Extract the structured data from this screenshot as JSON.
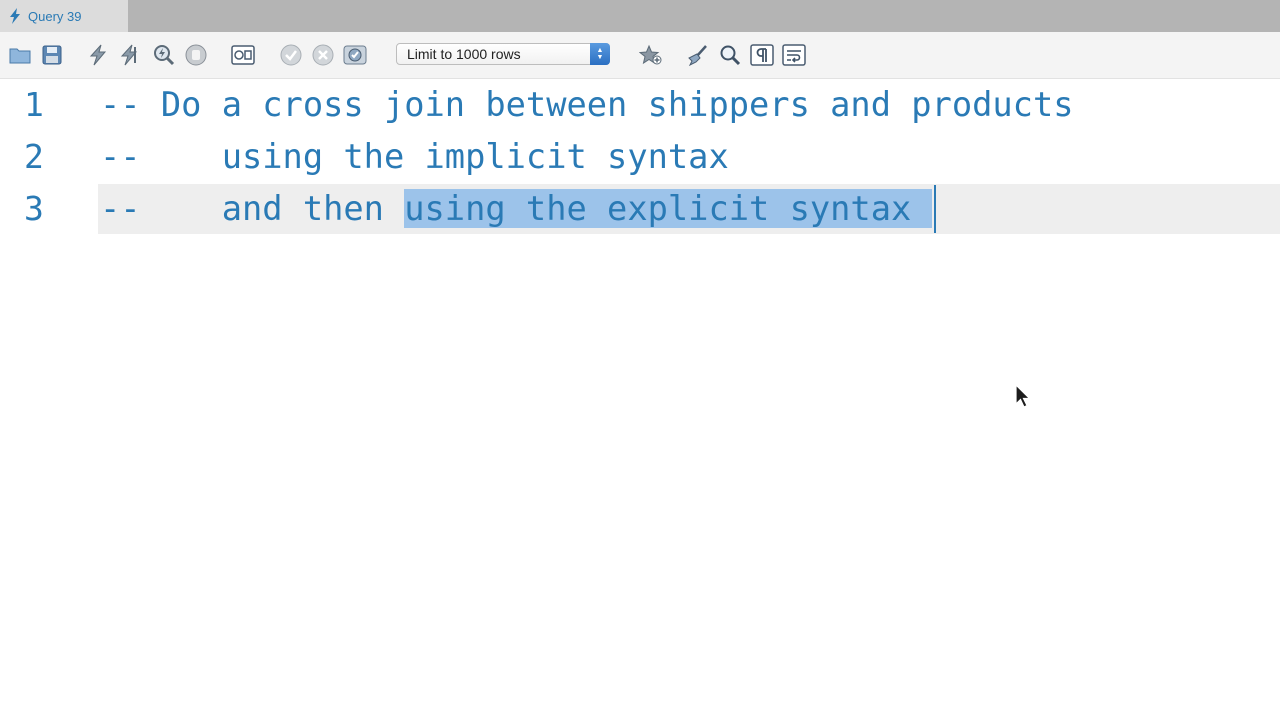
{
  "tab": {
    "title": "Query 39",
    "icon": "lightning-icon"
  },
  "toolbar": {
    "buttons": [
      {
        "name": "open-file",
        "icon": "folder-icon"
      },
      {
        "name": "save-file",
        "icon": "save-icon"
      },
      {
        "name": "execute",
        "icon": "lightning-icon"
      },
      {
        "name": "execute-current",
        "icon": "lightning-cursor-icon"
      },
      {
        "name": "explain",
        "icon": "magnifier-icon"
      },
      {
        "name": "stop",
        "icon": "stop-icon"
      },
      {
        "name": "toggle-results",
        "icon": "results-icon"
      },
      {
        "name": "commit",
        "icon": "check-circle-icon"
      },
      {
        "name": "rollback",
        "icon": "x-circle-icon"
      },
      {
        "name": "autocommit",
        "icon": "autocommit-icon"
      },
      {
        "name": "snippet",
        "icon": "star-icon"
      },
      {
        "name": "beautify",
        "icon": "broom-icon"
      },
      {
        "name": "find",
        "icon": "search-icon"
      },
      {
        "name": "invisible-chars",
        "icon": "pilcrow-icon"
      },
      {
        "name": "word-wrap",
        "icon": "wrap-icon"
      }
    ],
    "limit": {
      "value": "Limit to 1000 rows"
    }
  },
  "editor": {
    "lines": [
      {
        "number": "1",
        "text": "-- Do a cross join between shippers and products"
      },
      {
        "number": "2",
        "text": "--    using the implicit syntax"
      },
      {
        "number": "3",
        "text_before": "--    and then ",
        "text_selected": "using the explicit syntax "
      }
    ]
  },
  "colors": {
    "comment": "#2a7ab5",
    "selection": "#9cc3ea",
    "current_line": "#eeeeee",
    "tab_bar": "#b4b4b4"
  }
}
